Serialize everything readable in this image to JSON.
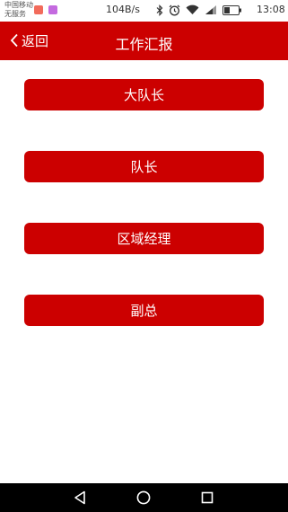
{
  "status_bar": {
    "carrier_line1": "中国移动",
    "carrier_line2": "无服务",
    "net_speed": "104B/s",
    "time": "13:08",
    "icons": [
      "notification-app-icon-orange",
      "notification-app-icon-purple",
      "bluetooth-icon",
      "alarm-icon",
      "wifi-icon",
      "signal-icon",
      "battery-icon"
    ]
  },
  "header": {
    "back_label": "返回",
    "title": "工作汇报",
    "background": "#cc0000"
  },
  "menu": {
    "items": [
      {
        "label": "大队长"
      },
      {
        "label": "队长"
      },
      {
        "label": "区域经理"
      },
      {
        "label": "副总"
      }
    ],
    "button_color": "#cc0000"
  },
  "nav_bar": {
    "icons": [
      "back-triangle-icon",
      "home-circle-icon",
      "recents-square-icon"
    ]
  }
}
